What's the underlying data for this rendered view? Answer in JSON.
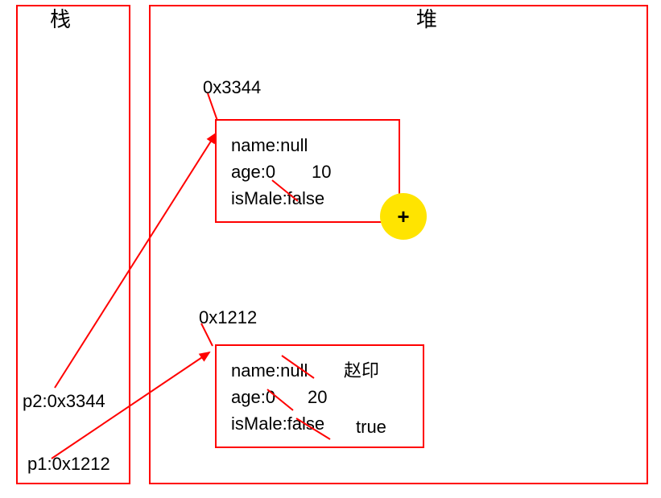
{
  "titles": {
    "stack": "栈",
    "heap": "堆"
  },
  "stack": {
    "p2_label": "p2:0x3344",
    "p1_label": "p1:0x1212"
  },
  "heap": {
    "obj1": {
      "address": "0x3344",
      "name_line": "name:null",
      "age_line": "age:0",
      "age_new": "10",
      "ismale_line": "isMale:false"
    },
    "obj2": {
      "address": "0x1212",
      "name_line": "name:null",
      "name_new": "赵印",
      "age_line": "age:0",
      "age_new": "20",
      "ismale_line": "isMale:false",
      "ismale_new": "true"
    }
  },
  "cursor": {
    "symbol": "+"
  }
}
